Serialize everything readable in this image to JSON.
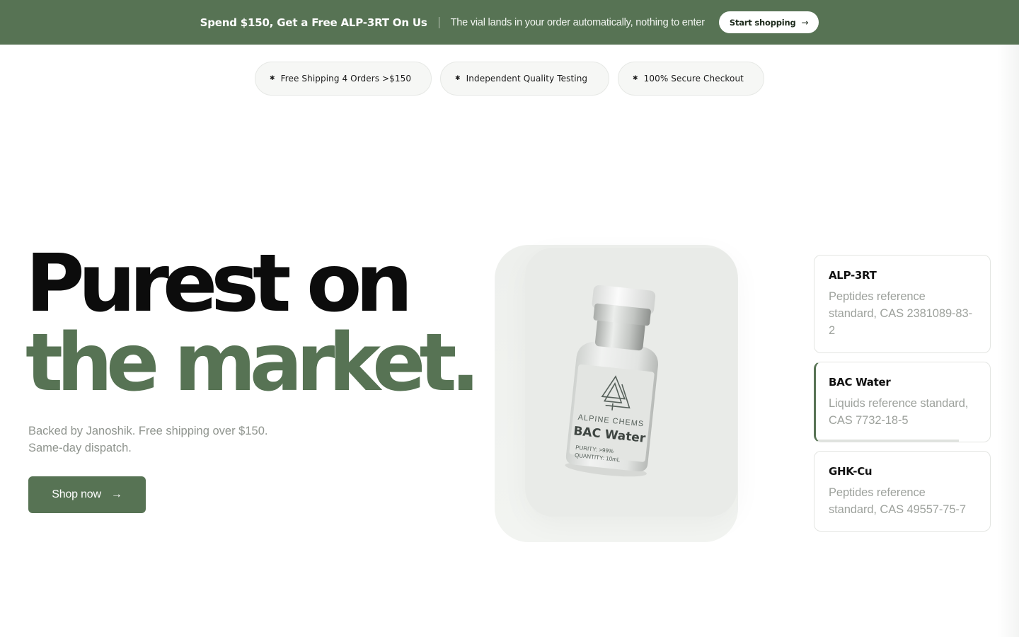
{
  "promo": {
    "title": "Spend $150, Get a Free ALP-3RT On Us",
    "subtitle": "The vial lands in your order automatically, nothing to enter",
    "button_label": "Start shopping",
    "arrow": "→",
    "bg_color": "#577354"
  },
  "trust_pills": [
    {
      "icon": "star-icon",
      "glyph": "✱",
      "label": "Free Shipping 4 Orders >$150"
    },
    {
      "icon": "star-icon",
      "glyph": "✱",
      "label": "Independent Quality Testing"
    },
    {
      "icon": "star-icon",
      "glyph": "✱",
      "label": "100% Secure Checkout"
    }
  ],
  "hero": {
    "headline_line1": "Purest on",
    "headline_line2": "the market.",
    "subtext_line1": "Backed by Janoshik. Free shipping over $150.",
    "subtext_line2": "Same-day dispatch.",
    "cta_label": "Shop now",
    "cta_arrow": "→",
    "accent_color": "#577354"
  },
  "product_image": {
    "brand": "ALPINE CHEMS",
    "product_name": "BAC Water",
    "purity_label": "PURITY:",
    "purity_value": ">99%",
    "quantity_label": "QUANTITY:",
    "quantity_value": "10mL"
  },
  "product_cards": [
    {
      "title": "ALP-3RT",
      "desc": "Peptides reference standard, CAS 2381089-83-2",
      "active": false
    },
    {
      "title": "BAC Water",
      "desc": "Liquids reference standard, CAS 7732-18-5",
      "active": true,
      "progress": 0.82
    },
    {
      "title": "GHK-Cu",
      "desc": "Peptides reference standard, CAS 49557-75-7",
      "active": false
    }
  ]
}
